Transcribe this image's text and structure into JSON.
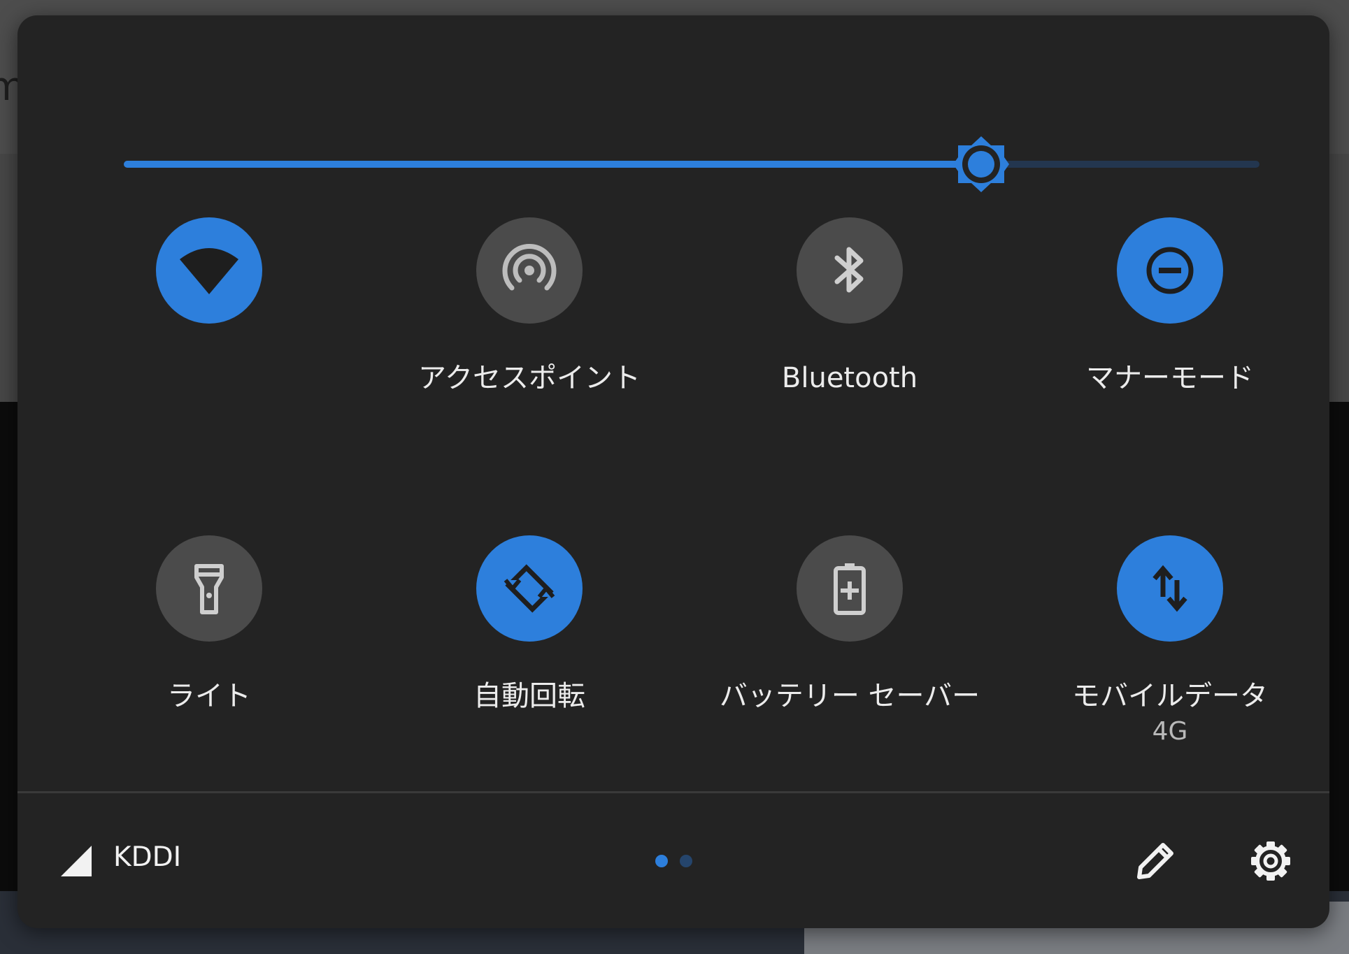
{
  "background": {
    "partial_letter": "m"
  },
  "brightness": {
    "level": 0.755,
    "accent_color": "#2d7fdc",
    "track_color": "#23364f"
  },
  "tiles": [
    {
      "id": "wifi",
      "label": "",
      "sub": "",
      "icon": "wifi-icon",
      "active": true
    },
    {
      "id": "hotspot",
      "label": "アクセスポイント",
      "sub": "",
      "icon": "hotspot-icon",
      "active": false
    },
    {
      "id": "bluetooth",
      "label": "Bluetooth",
      "sub": "",
      "icon": "bluetooth-icon",
      "active": false
    },
    {
      "id": "dnd",
      "label": "マナーモード",
      "sub": "",
      "icon": "do-not-disturb-icon",
      "active": true
    },
    {
      "id": "flashlight",
      "label": "ライト",
      "sub": "",
      "icon": "flashlight-icon",
      "active": false
    },
    {
      "id": "auto-rotate",
      "label": "自動回転",
      "sub": "",
      "icon": "auto-rotate-icon",
      "active": true
    },
    {
      "id": "battery-saver",
      "label": "バッテリー セーバー",
      "sub": "",
      "icon": "battery-saver-icon",
      "active": false
    },
    {
      "id": "mobile-data",
      "label": "モバイルデータ",
      "sub": "4G",
      "icon": "mobile-data-icon",
      "active": true
    }
  ],
  "footer": {
    "carrier": "KDDI",
    "page_indicator": {
      "current": 1,
      "total": 2
    },
    "icons": [
      "signal-icon",
      "edit-icon",
      "settings-icon"
    ]
  },
  "colors": {
    "active_tile": "#2d7fdc",
    "inactive_tile": "#4b4b4b",
    "panel": "#232323"
  }
}
